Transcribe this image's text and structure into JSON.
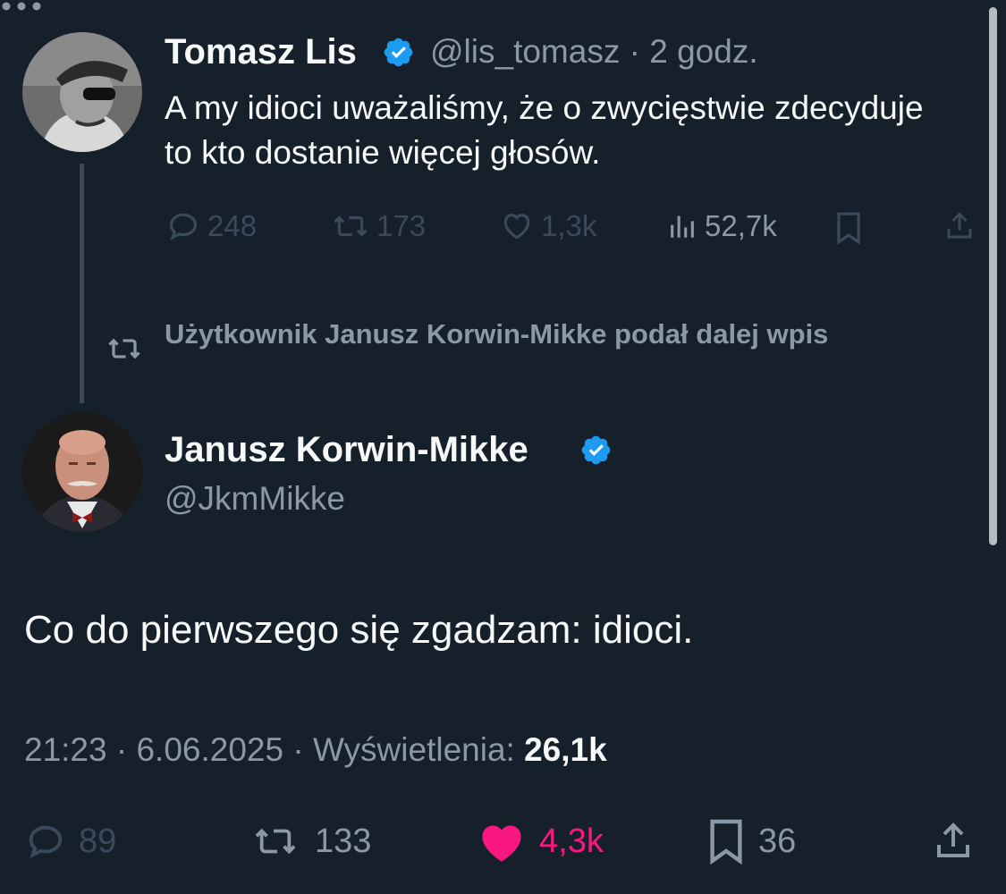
{
  "quoted_tweet": {
    "author_name": "Tomasz Lis",
    "handle": "@lis_tomasz",
    "separator": "·",
    "time": "2 godz.",
    "text": "A my idioci uważaliśmy, że o zwycięstwie zdecyduje to kto dostanie więcej głosów.",
    "replies": "248",
    "retweets": "173",
    "likes": "1,3k",
    "views": "52,7k"
  },
  "retweet_banner": "Użytkownik Janusz Korwin-Mikke podał dalej wpis",
  "main_tweet": {
    "author_name": "Janusz Korwin-Mikke",
    "handle": "@JkmMikke",
    "text": "Co do pierwszego się zgadzam: idioci.",
    "timestamp": "21:23 · 6.06.2025 · Wyświetlenia: ",
    "views": "26,1k",
    "replies": "89",
    "retweets": "133",
    "likes": "4,3k",
    "bookmarks": "36"
  },
  "colors": {
    "background": "#15202b",
    "verified": "#1d9bf0",
    "like_active": "#f91880",
    "muted": "#8b98a5"
  },
  "icons": [
    "verified-badge-icon",
    "more-icon",
    "reply-icon",
    "retweet-icon",
    "like-icon",
    "views-icon",
    "bookmark-icon",
    "share-icon"
  ]
}
